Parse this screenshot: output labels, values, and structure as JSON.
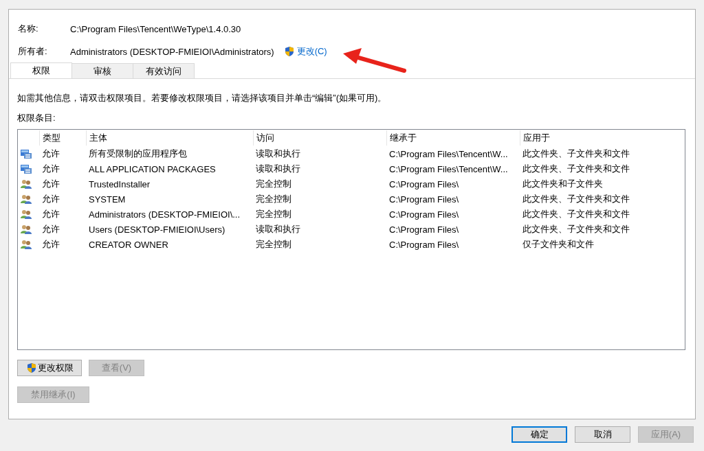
{
  "object": {
    "name_label": "名称:",
    "name_value": "C:\\Program Files\\Tencent\\WeType\\1.4.0.30",
    "owner_label": "所有者:",
    "owner_value": "Administrators (DESKTOP-FMIEIOI\\Administrators)",
    "change_link": "更改(C)"
  },
  "tabs": [
    {
      "label": "权限",
      "selected": true
    },
    {
      "label": "审核",
      "selected": false
    },
    {
      "label": "有效访问",
      "selected": false
    }
  ],
  "info_text": "如需其他信息，请双击权限项目。若要修改权限项目，请选择该项目并单击“编辑”(如果可用)。",
  "entries_label": "权限条目:",
  "table": {
    "columns": [
      "类型",
      "主体",
      "访问",
      "继承于",
      "应用于"
    ],
    "rows": [
      {
        "kind": "package",
        "cells": [
          "允许",
          "所有受限制的应用程序包",
          "读取和执行",
          "C:\\Program Files\\Tencent\\W...",
          "此文件夹、子文件夹和文件"
        ]
      },
      {
        "kind": "package",
        "cells": [
          "允许",
          "ALL APPLICATION PACKAGES",
          "读取和执行",
          "C:\\Program Files\\Tencent\\W...",
          "此文件夹、子文件夹和文件"
        ]
      },
      {
        "kind": "group",
        "cells": [
          "允许",
          "TrustedInstaller",
          "完全控制",
          "C:\\Program Files\\",
          "此文件夹和子文件夹"
        ]
      },
      {
        "kind": "group",
        "cells": [
          "允许",
          "SYSTEM",
          "完全控制",
          "C:\\Program Files\\",
          "此文件夹、子文件夹和文件"
        ]
      },
      {
        "kind": "group",
        "cells": [
          "允许",
          "Administrators (DESKTOP-FMIEIOI\\...",
          "完全控制",
          "C:\\Program Files\\",
          "此文件夹、子文件夹和文件"
        ]
      },
      {
        "kind": "group",
        "cells": [
          "允许",
          "Users (DESKTOP-FMIEIOI\\Users)",
          "读取和执行",
          "C:\\Program Files\\",
          "此文件夹、子文件夹和文件"
        ]
      },
      {
        "kind": "group",
        "cells": [
          "允许",
          "CREATOR OWNER",
          "完全控制",
          "C:\\Program Files\\",
          "仅子文件夹和文件"
        ]
      }
    ]
  },
  "panel_buttons": [
    {
      "label": "更改权限",
      "shield": true,
      "disabled": false
    },
    {
      "label": "查看(V)",
      "shield": false,
      "disabled": true
    }
  ],
  "inherit_button": {
    "label": "禁用继承(I)",
    "disabled": true
  },
  "dialog_buttons": [
    {
      "label": "确定",
      "default": true,
      "disabled": false
    },
    {
      "label": "取消",
      "default": false,
      "disabled": false
    },
    {
      "label": "应用(A)",
      "default": false,
      "disabled": true
    }
  ]
}
